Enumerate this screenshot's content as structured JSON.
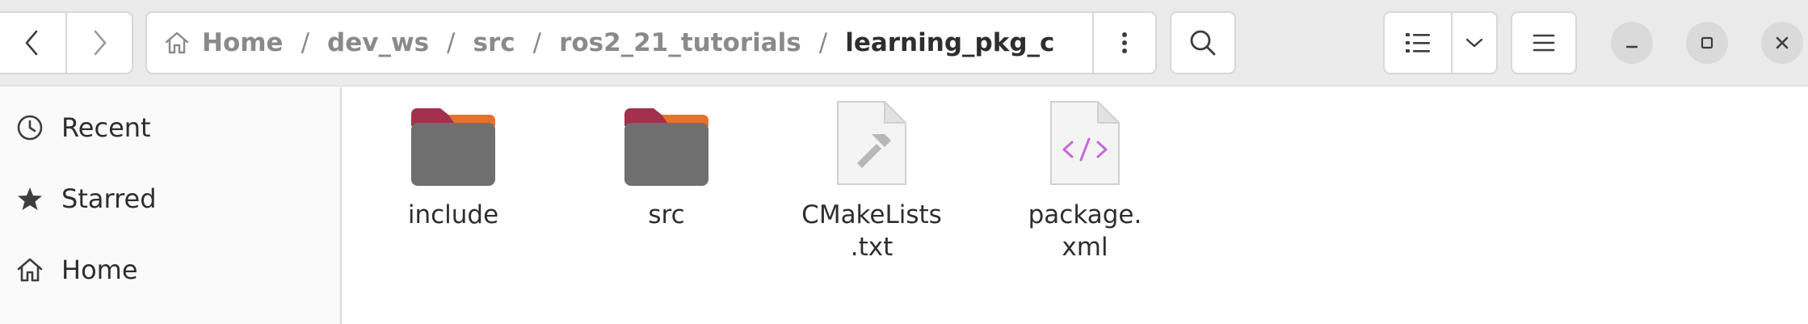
{
  "window": {
    "controls": {
      "minimize": "minimize",
      "maximize": "maximize",
      "close": "close"
    }
  },
  "breadcrumbs": [
    "Home",
    "dev_ws",
    "src",
    "ros2_21_tutorials",
    "learning_pkg_c"
  ],
  "sidebar": {
    "items": [
      {
        "label": "Recent",
        "icon": "clock-icon"
      },
      {
        "label": "Starred",
        "icon": "star-icon"
      },
      {
        "label": "Home",
        "icon": "home-icon"
      }
    ]
  },
  "files": [
    {
      "name": "include",
      "type": "folder"
    },
    {
      "name": "src",
      "type": "folder"
    },
    {
      "name": "CMakeLists\n.txt",
      "type": "build-script"
    },
    {
      "name": "package.\nxml",
      "type": "xml"
    }
  ],
  "colors": {
    "headerbar": "#ebebeb",
    "folder_body": "#6f6f6f",
    "folder_tab": "#a3304d",
    "folder_accent": "#e8702a",
    "xml_icon": "#c46ad6"
  }
}
